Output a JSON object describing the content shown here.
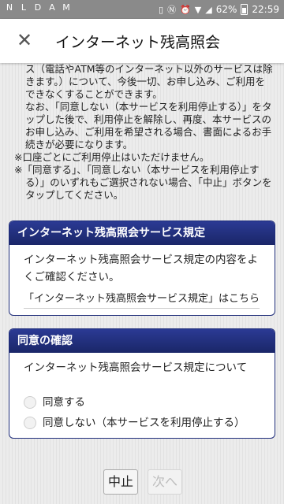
{
  "status_bar": {
    "battery_percent": "62%",
    "time": "22:59",
    "left_icons": [
      "N",
      "L",
      "D",
      "A",
      "M"
    ],
    "right_icons": [
      "wifi-icon",
      "vibrate-icon",
      "nfc-icon",
      "alarm-icon",
      "signal-icon"
    ]
  },
  "app_bar": {
    "title": "インターネット残高照会",
    "close_icon": "close-icon"
  },
  "notice": {
    "lines": [
      "ス（電話やATM等のインターネット以外のサービスは除きます。）について、今後一切、お申し込み、ご利用をできなくすることができます。",
      "なお、「同意しない（本サービスを利用停止する）」をタップした後で、利用停止を解除し、再度、本サービスのお申し込み、ご利用を希望される場合、書面によるお手続きが必要になります。",
      "※口座ごとにご利用停止はいただけません。",
      "※「同意する」、「同意しない（本サービスを利用停止する）」のいずれもご選択されない場合、「中止」ボタンをタップしてください。"
    ]
  },
  "terms_card": {
    "header": "インターネット残高照会サービス規定",
    "body": "インターネット残高照会サービス規定の内容をよくご確認ください。",
    "link": "「インターネット残高照会サービス規定」はこちら"
  },
  "consent_card": {
    "header": "同意の確認",
    "body": "インターネット残高照会サービス規定について",
    "options": [
      "同意する",
      "同意しない（本サービスを利用停止する）"
    ]
  },
  "footer": {
    "cancel_label": "中止",
    "next_label": "次へ"
  }
}
